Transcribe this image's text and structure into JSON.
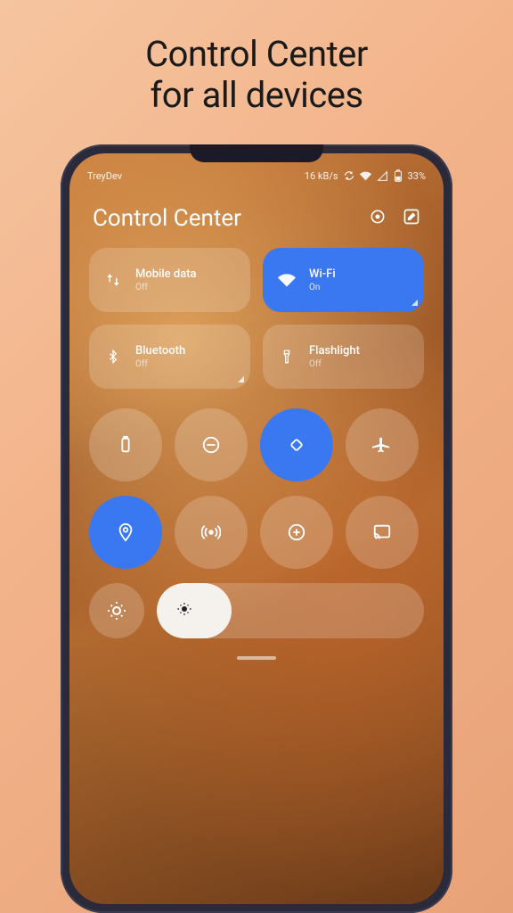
{
  "promo": {
    "line1": "Control Center",
    "line2": "for all devices"
  },
  "status": {
    "carrier": "TreyDev",
    "speed": "16 kB/s",
    "battery": "33%"
  },
  "header": {
    "title": "Control Center"
  },
  "tiles": {
    "mobile_data": {
      "label": "Mobile data",
      "status": "Off"
    },
    "wifi": {
      "label": "Wi-Fi",
      "status": "On"
    },
    "bluetooth": {
      "label": "Bluetooth",
      "status": "Off"
    },
    "flashlight": {
      "label": "Flashlight",
      "status": "Off"
    }
  },
  "toggles": {
    "row1": [
      "battery-saver",
      "dnd",
      "rotate",
      "airplane"
    ],
    "row2": [
      "location",
      "hotspot",
      "add",
      "cast"
    ]
  },
  "active_toggles": [
    "rotate",
    "location"
  ],
  "brightness_pct": 28,
  "colors": {
    "accent": "#3a78f2"
  }
}
